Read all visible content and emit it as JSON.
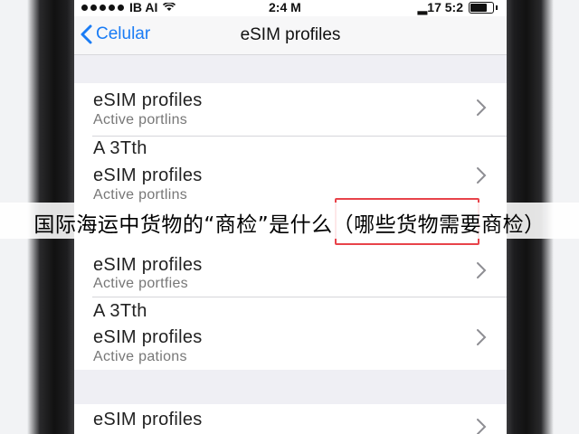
{
  "status_bar": {
    "carrier": "IB AI",
    "time": "2:4 M",
    "battery_label": "▂17 5:2"
  },
  "nav": {
    "back_label": "Celular",
    "title": "eSIM profiles"
  },
  "list": [
    {
      "type": "item",
      "title": "eSIM profiles",
      "subtitle": "Active portlins"
    },
    {
      "type": "header",
      "title": "A 3Tth"
    },
    {
      "type": "item",
      "title": "eSIM profiles",
      "subtitle": "Active portlins"
    },
    {
      "type": "item",
      "title": "eSIM profiles",
      "subtitle": "Active portfies"
    },
    {
      "type": "header",
      "title": "A 3Tth"
    },
    {
      "type": "item",
      "title": "eSIM profiles",
      "subtitle": "Active pations"
    },
    {
      "type": "item",
      "title": "eSIM profiles",
      "subtitle": ""
    }
  ],
  "caption": "国际海运中货物的“商检”是什么（哪些货物需要商检）",
  "colors": {
    "accent": "#1a7cf5",
    "highlight": "#e8434a",
    "background": "#efeff4"
  },
  "icons": [
    "signal-dots-icon",
    "wifi-icon",
    "battery-icon",
    "back-chevron-icon",
    "chevron-right-icon"
  ]
}
